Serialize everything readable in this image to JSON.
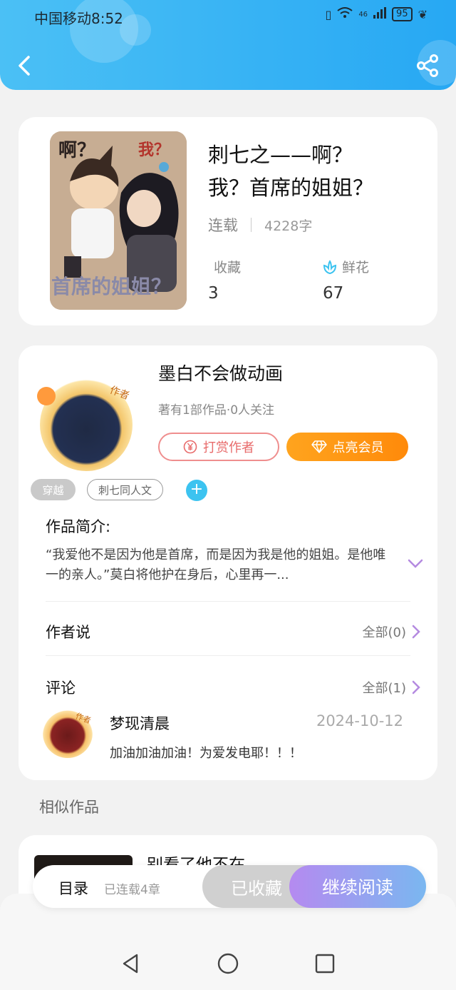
{
  "status_bar": {
    "carrier_time": "中国移动8:52",
    "network": "46",
    "battery": "95"
  },
  "header": {
    "back_icon": "chevron-left-icon",
    "share_icon": "share-icon"
  },
  "book": {
    "cover_text_1": "啊？",
    "cover_text_2": "我？",
    "cover_text_3": "首席的姐姐？",
    "title_line1": "刺七之——啊？",
    "title_line2": "我？首席的姐姐？",
    "status": "连载",
    "word_count": "4228字",
    "favorites_label": "收藏",
    "favorites_count": "3",
    "flowers_label": "鲜花",
    "flowers_count": "67"
  },
  "author": {
    "name": "墨白不会做动画",
    "meta": "著有1部作品·0人关注",
    "badge": "作者",
    "reward_label": "打赏作者",
    "vip_label": "点亮会员"
  },
  "tags": [
    "穿越",
    "刺七同人文"
  ],
  "synopsis": {
    "label": "作品简介:",
    "text": "“我爱他不是因为他是首席，而是因为我是他的姐姐。是他唯一的亲人。”莫白将他护在身后，心里再一..."
  },
  "author_says": {
    "label": "作者说",
    "all": "全部(0)"
  },
  "comments": {
    "label": "评论",
    "all": "全部(1)",
    "items": [
      {
        "user": "梦现清晨",
        "badge": "作者",
        "date": "2024-10-12",
        "text": "加油加油加油！为爱发电耶！！！"
      }
    ]
  },
  "similar": {
    "title": "相似作品",
    "items": [
      {
        "name": "别看了他不在"
      }
    ]
  },
  "bottom_bar": {
    "toc": "目录",
    "toc_count": "已连载4章",
    "collected": "已收藏",
    "continue": "继续阅读"
  },
  "colors": {
    "header": "#27a8f3",
    "vip": "#ff8a0a",
    "reward": "#e86b6b",
    "read_gradient_start": "#b58af0",
    "read_gradient_end": "#7ab7f0",
    "tag_add": "#3cc3f0",
    "chevron": "#b48ae0"
  }
}
